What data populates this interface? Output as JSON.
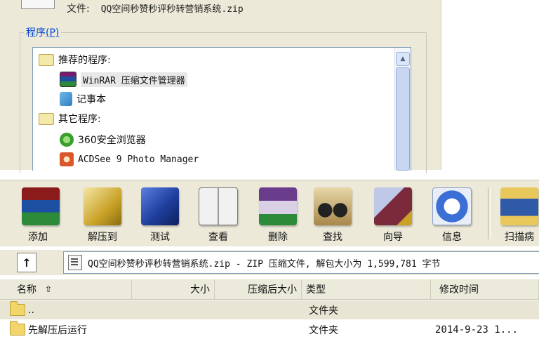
{
  "open_with_dialog": {
    "file_label": "文件:",
    "file_name": "QQ空间秒赞秒评秒转营销系统.zip",
    "programs_group_label": "程序",
    "programs_group_hotkey": "(P)",
    "list": [
      {
        "kind": "category",
        "label": "推荐的程序:",
        "icon": "folder-icon"
      },
      {
        "kind": "program",
        "label": "WinRAR 压缩文件管理器",
        "icon": "winrar-icon",
        "selected": true
      },
      {
        "kind": "program",
        "label": "记事本",
        "icon": "notepad-icon"
      },
      {
        "kind": "category",
        "label": "其它程序:",
        "icon": "folder-icon"
      },
      {
        "kind": "program",
        "label": "360安全浏览器",
        "icon": "360-browser-icon"
      },
      {
        "kind": "program",
        "label": "ACDSee 9 Photo Manager",
        "icon": "acdsee-icon"
      }
    ]
  },
  "winrar": {
    "toolbar": [
      {
        "label": "添加",
        "icon": "add-archive-icon",
        "color": "#8b1a1a"
      },
      {
        "label": "解压到",
        "icon": "extract-to-icon",
        "color": "#c9a227"
      },
      {
        "label": "测试",
        "icon": "test-icon",
        "color": "#1f3f9e"
      },
      {
        "label": "查看",
        "icon": "view-icon",
        "color": "#b7b7b7"
      },
      {
        "label": "删除",
        "icon": "delete-icon",
        "color": "#6a3c8c"
      },
      {
        "label": "查找",
        "icon": "find-icon",
        "color": "#5a5a5a"
      },
      {
        "label": "向导",
        "icon": "wizard-icon",
        "color": "#7a2a3a"
      },
      {
        "label": "信息",
        "icon": "info-icon",
        "color": "#3b6fd6"
      },
      {
        "label": "扫描病",
        "icon": "scan-virus-icon",
        "color": "#2f5aa8"
      }
    ],
    "up_button": "↑",
    "path_text": "QQ空间秒赞秒评秒转营销系统.zip - ZIP 压缩文件, 解包大小为 1,599,781 字节",
    "columns": [
      "名称",
      "大小",
      "压缩后大小",
      "类型",
      "修改时间"
    ],
    "sort_indicator": "⇧",
    "rows": [
      {
        "name": "..",
        "size": "",
        "packed": "",
        "type": "文件夹",
        "modified": ""
      },
      {
        "name": "先解压后运行",
        "size": "",
        "packed": "",
        "type": "文件夹",
        "modified": "2014-9-23 1..."
      }
    ]
  }
}
